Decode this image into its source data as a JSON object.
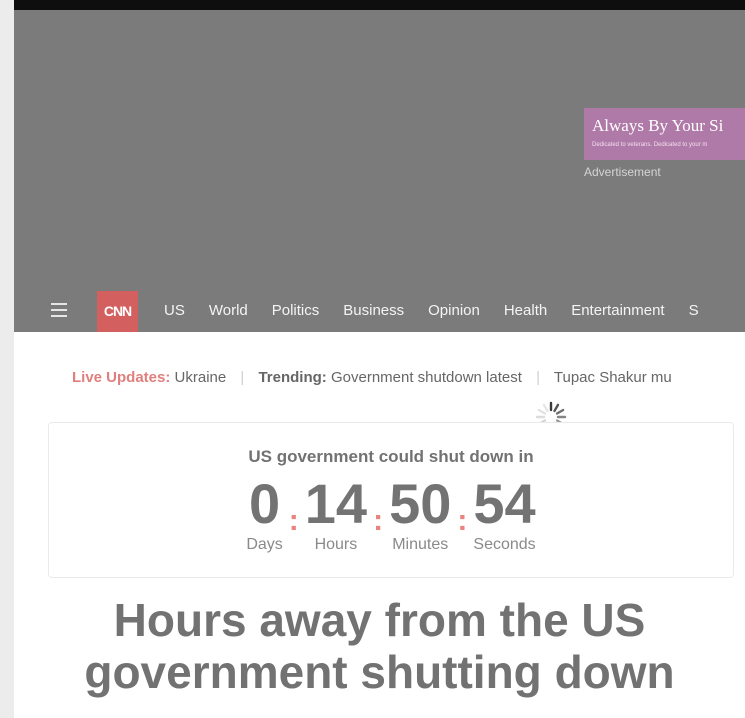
{
  "ad": {
    "title": "Always By Your Si",
    "subtitle": "Dedicated to veterans. Dedicated to your m",
    "label": "Advertisement"
  },
  "nav": {
    "logo": "CNN",
    "items": [
      "US",
      "World",
      "Politics",
      "Business",
      "Opinion",
      "Health",
      "Entertainment",
      "S"
    ]
  },
  "trending": {
    "live_label": "Live Updates:",
    "live_value": "Ukraine",
    "trending_label": "Trending:",
    "trending_value": "Government shutdown latest",
    "extra": "Tupac Shakur mu"
  },
  "countdown": {
    "heading": "US government could shut down in",
    "units": [
      {
        "value": "0",
        "label": "Days"
      },
      {
        "value": "14",
        "label": "Hours"
      },
      {
        "value": "50",
        "label": "Minutes"
      },
      {
        "value": "54",
        "label": "Seconds"
      }
    ],
    "separator": ":"
  },
  "headline": {
    "line1": "Hours away from the US",
    "line2": "government shutting down"
  },
  "colors": {
    "accent": "#d45f5f",
    "overlay_gray": "#7b7b7b"
  }
}
